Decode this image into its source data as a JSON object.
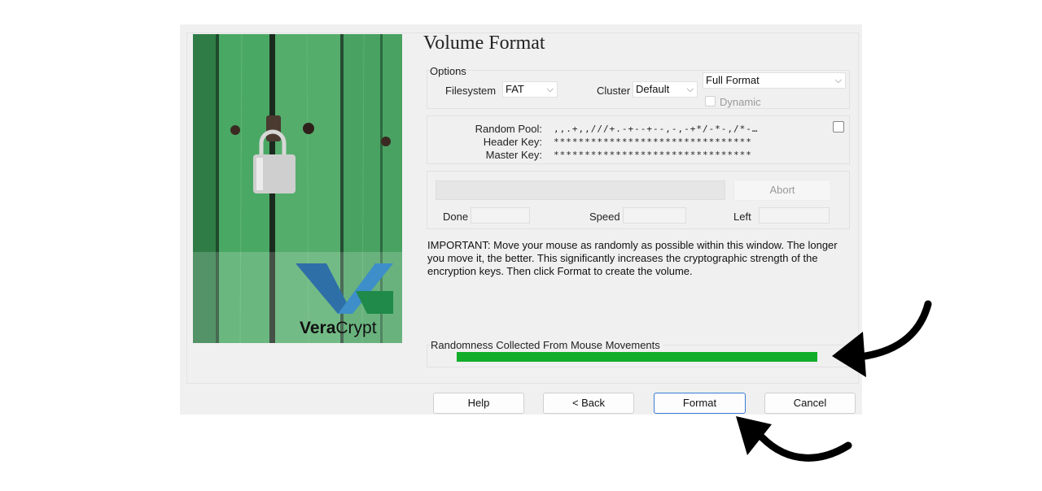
{
  "page": {
    "title": "Volume Format"
  },
  "sidebar": {
    "logo_text_1": "Vera",
    "logo_text_2": "Crypt"
  },
  "options": {
    "label": "Options",
    "filesystem_label": "Filesystem",
    "filesystem_value": "FAT",
    "cluster_label": "Cluster",
    "cluster_value": "Default",
    "format_mode_value": "Full Format",
    "dynamic_label": "Dynamic"
  },
  "keys": {
    "random_pool_label": "Random Pool:",
    "random_pool_value": ",,.+,,///+.-+--+--,-,-+*/-*-,/*-…",
    "header_key_label": "Header Key:",
    "header_key_value": "********************************",
    "master_key_label": "Master Key:",
    "master_key_value": "********************************"
  },
  "progress": {
    "abort_label": "Abort",
    "done_label": "Done",
    "speed_label": "Speed",
    "left_label": "Left"
  },
  "info": {
    "important_text": "IMPORTANT: Move your mouse as randomly as possible within this window. The longer you move it, the better. This significantly increases the cryptographic strength of the encryption keys. Then click Format to create the volume."
  },
  "randomness": {
    "label": "Randomness Collected From Mouse Movements",
    "level": 1.0,
    "color": "#12ad2b"
  },
  "buttons": {
    "help": "Help",
    "back": "< Back",
    "format": "Format",
    "cancel": "Cancel"
  },
  "annotations": {
    "arrow_color": "#000000"
  }
}
